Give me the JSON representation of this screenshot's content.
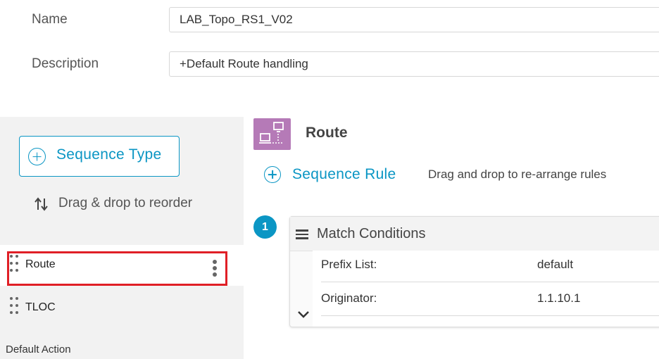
{
  "form": {
    "name_label": "Name",
    "name_value": "LAB_Topo_RS1_V02",
    "description_label": "Description",
    "description_value": "+Default Route handling"
  },
  "sidebar": {
    "sequence_type_label": "Sequence Type",
    "reorder_hint": "Drag & drop to reorder",
    "items": [
      {
        "label": "Route"
      },
      {
        "label": "TLOC"
      }
    ],
    "default_action_label": "Default Action"
  },
  "main": {
    "title": "Route",
    "sequence_rule_label": "Sequence Rule",
    "rearrange_hint": "Drag and drop to re-arrange rules",
    "rule": {
      "number": "1",
      "match_title": "Match Conditions",
      "conditions": [
        {
          "key": "Prefix List:",
          "value": "default"
        },
        {
          "key": "Originator:",
          "value": "1.1.10.1"
        }
      ]
    }
  },
  "colors": {
    "accent": "#0b96c4",
    "route_icon_bg": "#b57ab7",
    "highlight": "#e01f26"
  },
  "icons": {
    "add": "plus-circle-icon",
    "reorder": "reorder-arrows-icon",
    "grip": "drag-grip-icon",
    "more": "kebab-menu-icon",
    "route": "route-network-icon",
    "menu": "hamburger-icon",
    "expand": "chevron-down-icon"
  }
}
